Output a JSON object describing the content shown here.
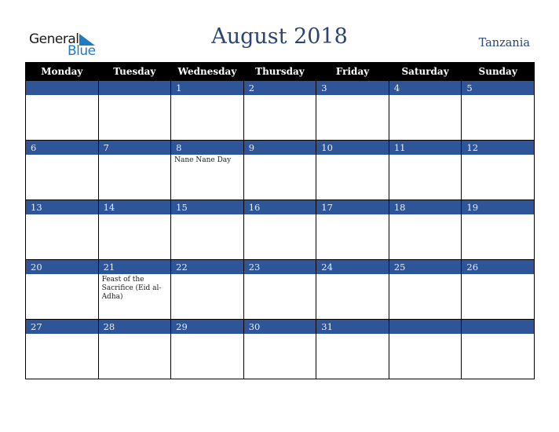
{
  "logo": {
    "word1": "General",
    "word2": "Blue"
  },
  "title": "August 2018",
  "country": "Tanzania",
  "colors": {
    "band": "#2e5597",
    "title": "#2b4472",
    "logo_blue": "#1f7bc1",
    "header_bg": "#000000"
  },
  "weekdays": [
    "Monday",
    "Tuesday",
    "Wednesday",
    "Thursday",
    "Friday",
    "Saturday",
    "Sunday"
  ],
  "weeks": [
    [
      {
        "day": "",
        "event": ""
      },
      {
        "day": "",
        "event": ""
      },
      {
        "day": "1",
        "event": ""
      },
      {
        "day": "2",
        "event": ""
      },
      {
        "day": "3",
        "event": ""
      },
      {
        "day": "4",
        "event": ""
      },
      {
        "day": "5",
        "event": ""
      }
    ],
    [
      {
        "day": "6",
        "event": ""
      },
      {
        "day": "7",
        "event": ""
      },
      {
        "day": "8",
        "event": "Nane Nane Day"
      },
      {
        "day": "9",
        "event": ""
      },
      {
        "day": "10",
        "event": ""
      },
      {
        "day": "11",
        "event": ""
      },
      {
        "day": "12",
        "event": ""
      }
    ],
    [
      {
        "day": "13",
        "event": ""
      },
      {
        "day": "14",
        "event": ""
      },
      {
        "day": "15",
        "event": ""
      },
      {
        "day": "16",
        "event": ""
      },
      {
        "day": "17",
        "event": ""
      },
      {
        "day": "18",
        "event": ""
      },
      {
        "day": "19",
        "event": ""
      }
    ],
    [
      {
        "day": "20",
        "event": ""
      },
      {
        "day": "21",
        "event": "Feast of the Sacrifice (Eid al-Adha)"
      },
      {
        "day": "22",
        "event": ""
      },
      {
        "day": "23",
        "event": ""
      },
      {
        "day": "24",
        "event": ""
      },
      {
        "day": "25",
        "event": ""
      },
      {
        "day": "26",
        "event": ""
      }
    ],
    [
      {
        "day": "27",
        "event": ""
      },
      {
        "day": "28",
        "event": ""
      },
      {
        "day": "29",
        "event": ""
      },
      {
        "day": "30",
        "event": ""
      },
      {
        "day": "31",
        "event": ""
      },
      {
        "day": "",
        "event": ""
      },
      {
        "day": "",
        "event": ""
      }
    ]
  ]
}
